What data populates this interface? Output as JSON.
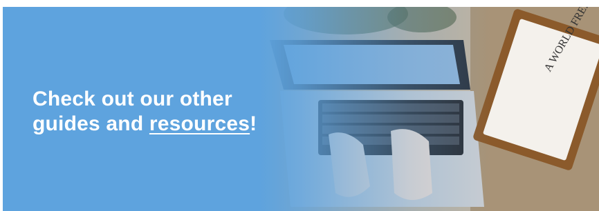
{
  "banner": {
    "line1": "Check out our other",
    "line2_prefix": "guides and ",
    "link_text": "resources",
    "line2_suffix": "!",
    "book_title": "A WORLD FREE"
  },
  "colors": {
    "background": "#5ea3de",
    "text": "#ffffff"
  },
  "image": {
    "subject": "hands typing on laptop beside a book on a wooden tray"
  }
}
